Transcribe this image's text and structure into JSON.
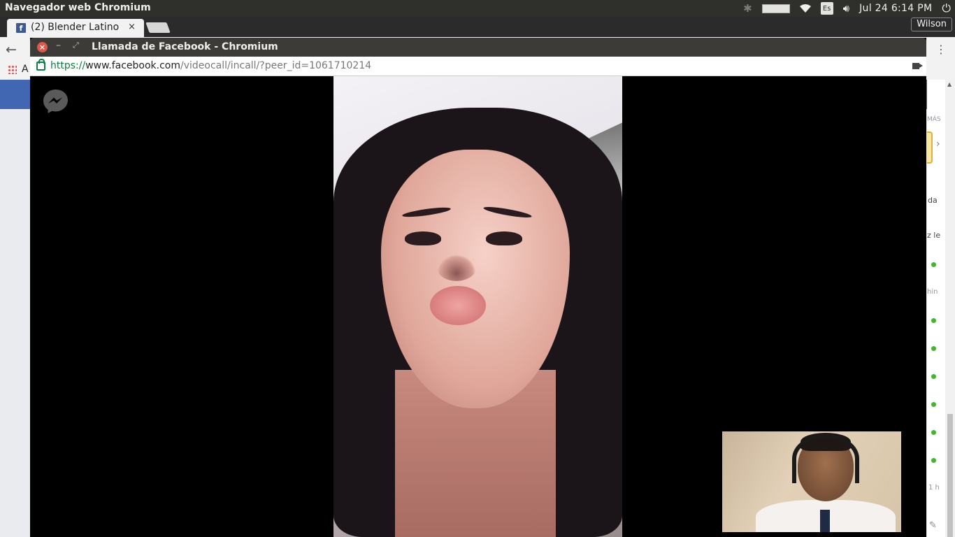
{
  "top_panel": {
    "app_title": "Navegador web Chromium",
    "keyboard_layout": "Es",
    "clock": "Jul 24  6:14 PM"
  },
  "browser": {
    "tab_title": "(2) Blender Latino",
    "tab_close": "×",
    "profile_name": "Wilson",
    "bookmarks_partial": "A"
  },
  "popup": {
    "title": "Llamada de Facebook - Chromium",
    "url_scheme": "https://",
    "url_host": "www.facebook.com",
    "url_path": "/videocall/incall/?peer_id=1061710214"
  },
  "sidebar_partial": {
    "heading": "MÁS",
    "text_1": "da",
    "text_2": "z le",
    "text_3": "hin",
    "text_4": "1 h"
  },
  "colors": {
    "facebook_blue": "#4267b2",
    "online_green": "#42b72a",
    "secure_green": "#0b8043"
  }
}
